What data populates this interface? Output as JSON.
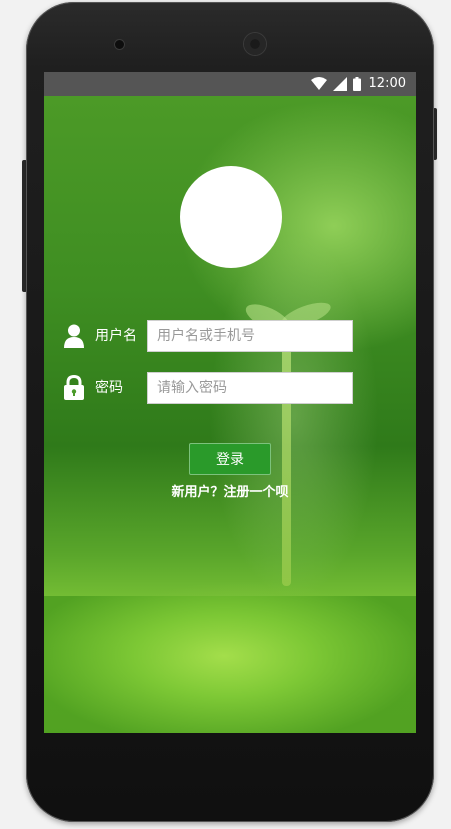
{
  "status_bar": {
    "time": "12:00",
    "icons": [
      "wifi-icon",
      "signal-icon",
      "battery-icon"
    ]
  },
  "login": {
    "username_label": "用户名",
    "username_placeholder": "用户名或手机号",
    "username_value": "",
    "password_label": "密码",
    "password_placeholder": "请输入密码",
    "password_value": "",
    "login_button": "登录",
    "register_link": "新用户？注册一个呗"
  },
  "colors": {
    "button": "#2a9a2a",
    "status_bar": "#555555",
    "background": "#3f8e22"
  }
}
